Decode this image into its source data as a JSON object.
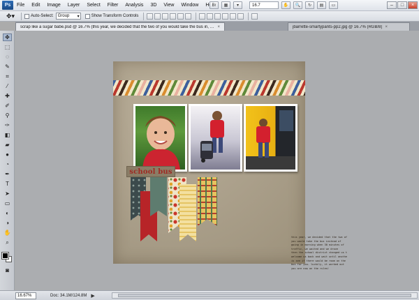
{
  "app": {
    "logo": "Ps",
    "zoom_display": "16.7"
  },
  "menu": [
    "File",
    "Edit",
    "Image",
    "Layer",
    "Select",
    "Filter",
    "Analysis",
    "3D",
    "View",
    "Window",
    "Help"
  ],
  "window_controls": {
    "minimize": "–",
    "maximize": "□",
    "close": "×"
  },
  "options_bar": {
    "auto_select_label": "Auto-Select:",
    "auto_select_value": "Group",
    "show_transform_label": "Show Transform Controls"
  },
  "tabs": [
    {
      "label": "scrap like a sugar babe.psd @ 16.7% (this year, we decided that the two of you would take the bus in, RGB/8) *",
      "close": "×"
    },
    {
      "label": "jbarrette-smartypants-pp2.jpg @ 16.7% (RGB/8)",
      "close": "×"
    }
  ],
  "layout": {
    "title": "school bus",
    "journal_lines": [
      "this year, we decided that the two of",
      "you would take the bus instead of",
      "going in morning when 30 minutes of",
      "traffic, we waited and we drove",
      "then the school district changed us to",
      "welcome us back and wait until another",
      "is see if there would be room on the",
      "bus for you. luckily, it worked out",
      "you are now on the rules!"
    ]
  },
  "status_bar": {
    "zoom": "16.67%",
    "doc": "Doc: 34.1M/124.8M",
    "arrow": "▶"
  },
  "icons": {
    "move_tool": "move-tool-icon",
    "marquee_tool": "marquee-tool-icon",
    "lasso_tool": "lasso-tool-icon",
    "crop_tool": "crop-tool-icon"
  },
  "colors": {
    "canvas_bg": "#abadb0",
    "page_bg": "#aca18c",
    "title_red": "#9e2a23",
    "ps_blue": "#2f6db5"
  }
}
